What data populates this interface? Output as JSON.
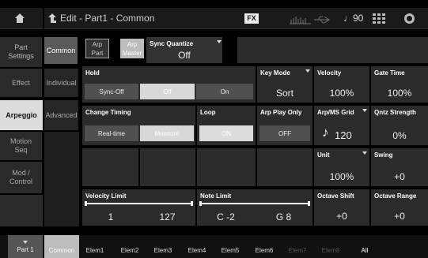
{
  "header": {
    "title": "Edit - Part1 - Common",
    "fx": "FX",
    "tempo_note": "♩",
    "tempo": "90"
  },
  "left": {
    "part_settings": "Part\nSettings",
    "common": "Common",
    "effect": "Effect",
    "individual": "Individual",
    "arpeggio": "Arpeggio",
    "advanced": "Advanced",
    "motion_seq": "Motion\nSeq",
    "mod_control": "Mod /\nControl"
  },
  "arp": {
    "arp_part": "Arp\nPart",
    "arp_master": "Arp\nMaster",
    "sync_quantize_label": "Sync Quantize",
    "sync_quantize_value": "Off"
  },
  "hold": {
    "label": "Hold",
    "options": [
      "Sync-Off",
      "Off",
      "On"
    ],
    "selected": 1
  },
  "key_mode": {
    "label": "Key Mode",
    "value": "Sort"
  },
  "velocity": {
    "label": "Velocity",
    "value": "100%"
  },
  "gate_time": {
    "label": "Gate Time",
    "value": "100%"
  },
  "change_timing": {
    "label": "Change Timing",
    "options": [
      "Real-time",
      "Measure"
    ],
    "selected": 1
  },
  "loop": {
    "label": "Loop",
    "value": "ON"
  },
  "arp_play_only": {
    "label": "Arp Play Only",
    "value": "OFF"
  },
  "arp_ms_grid": {
    "label": "Arp/MS Grid",
    "note": "♪",
    "value": "120"
  },
  "qntz_strength": {
    "label": "Qntz Strength",
    "value": "0%"
  },
  "unit": {
    "label": "Unit",
    "value": "100%"
  },
  "swing": {
    "label": "Swing",
    "value": "+0"
  },
  "velocity_limit": {
    "label": "Velocity Limit",
    "low": "1",
    "high": "127"
  },
  "note_limit": {
    "label": "Note Limit",
    "low": "C -2",
    "high": "G 8"
  },
  "octave_shift": {
    "label": "Octave Shift",
    "value": "+0"
  },
  "octave_range": {
    "label": "Octave Range",
    "value": "+0"
  },
  "bottom": {
    "part": "Part 1",
    "common": "Common",
    "elems": [
      "Elem1",
      "Elem2",
      "Elem3",
      "Elem4",
      "Elem5",
      "Elem6",
      "Elem7",
      "Elem8"
    ],
    "all": "All"
  }
}
